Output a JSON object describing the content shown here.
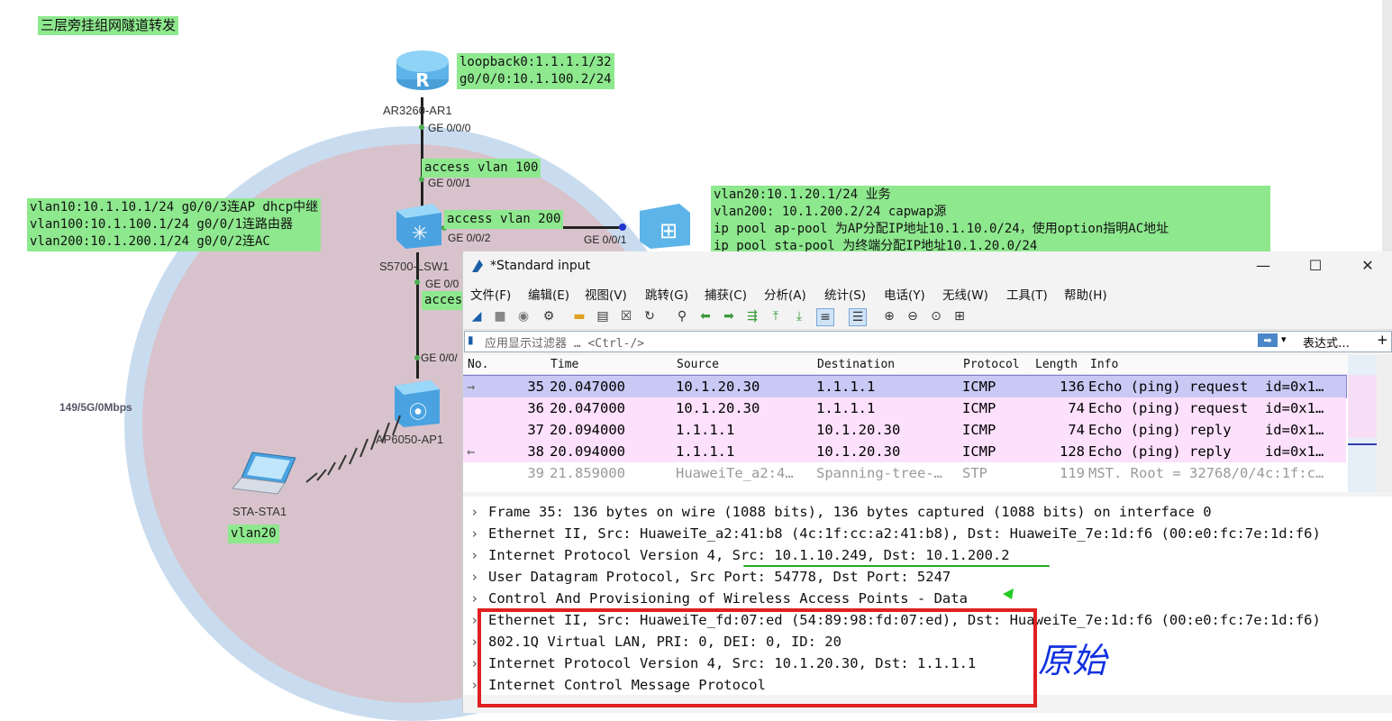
{
  "diagram": {
    "title": "三层旁挂组网隧道转发",
    "ar_info": [
      "loopback0:1.1.1.1/32",
      "g0/0/0:10.1.100.2/24"
    ],
    "ar_name": "AR3260-AR1",
    "ar_port": "GE 0/0/0",
    "access_vlan_100": "access vlan 100",
    "lsw_port_up": "GE 0/0/1",
    "access_vlan_200": "access vlan 200",
    "lsw_port_right": "GE 0/0/2",
    "ac_port": "GE 0/0/1",
    "lsw_info": [
      "vlan10:10.1.10.1/24 g0/0/3连AP dhcp中继",
      "vlan100:10.1.100.1/24 g0/0/1连路由器",
      "vlan200:10.1.200.1/24 g0/0/2连AC"
    ],
    "lsw_name": "S5700-LSW1",
    "lsw_port_down": "GE 0/0",
    "access_partial": "acces",
    "ap_port": "GE 0/0/",
    "ap_name": "AP6050-AP1",
    "wlan_rate": "149/5G/0Mbps",
    "sta_name": "STA-STA1",
    "sta_vlan": "vlan20",
    "ac_info": [
      "vlan20:10.1.20.1/24 业务",
      "vlan200: 10.1.200.2/24 capwap源",
      "ip pool ap-pool 为AP分配IP地址10.1.10.0/24，使用option指明AC地址",
      "ip pool sta-pool 为终端分配IP地址10.1.20.0/24"
    ]
  },
  "wireshark": {
    "title": "*Standard input",
    "menu": [
      "文件(F)",
      "编辑(E)",
      "视图(V)",
      "跳转(G)",
      "捕获(C)",
      "分析(A)",
      "统计(S)",
      "电话(Y)",
      "无线(W)",
      "工具(T)",
      "帮助(H)"
    ],
    "filter_placeholder": "应用显示过滤器 … <Ctrl-/>",
    "expression_label": "表达式…",
    "columns": [
      "No.",
      "Time",
      "Source",
      "Destination",
      "Protocol",
      "Length",
      "Info"
    ],
    "packets": [
      {
        "no": "35",
        "time": "20.047000",
        "src": "10.1.20.30",
        "dst": "1.1.1.1",
        "proto": "ICMP",
        "len": "136",
        "info": "Echo (ping) request  id=0x1…"
      },
      {
        "no": "36",
        "time": "20.047000",
        "src": "10.1.20.30",
        "dst": "1.1.1.1",
        "proto": "ICMP",
        "len": "74",
        "info": "Echo (ping) request  id=0x1…"
      },
      {
        "no": "37",
        "time": "20.094000",
        "src": "1.1.1.1",
        "dst": "10.1.20.30",
        "proto": "ICMP",
        "len": "74",
        "info": "Echo (ping) reply    id=0x1…"
      },
      {
        "no": "38",
        "time": "20.094000",
        "src": "1.1.1.1",
        "dst": "10.1.20.30",
        "proto": "ICMP",
        "len": "128",
        "info": "Echo (ping) reply    id=0x1…"
      },
      {
        "no": "39",
        "time": "21.859000",
        "src": "HuaweiTe_a2:4…",
        "dst": "Spanning-tree-…",
        "proto": "STP",
        "len": "119",
        "info": "MST. Root = 32768/0/4c:1f:c…"
      }
    ],
    "details": [
      "Frame 35: 136 bytes on wire (1088 bits), 136 bytes captured (1088 bits) on interface 0",
      "Ethernet II, Src: HuaweiTe_a2:41:b8 (4c:1f:cc:a2:41:b8), Dst: HuaweiTe_7e:1d:f6 (00:e0:fc:7e:1d:f6)",
      "Internet Protocol Version 4, Src: 10.1.10.249, Dst: 10.1.200.2",
      "User Datagram Protocol, Src Port: 54778, Dst Port: 5247",
      "Control And Provisioning of Wireless Access Points - Data",
      "Ethernet II, Src: HuaweiTe_fd:07:ed (54:89:98:fd:07:ed), Dst: HuaweiTe_7e:1d:f6 (00:e0:fc:7e:1d:f6)",
      "802.1Q Virtual LAN, PRI: 0, DEI: 0, ID: 20",
      "Internet Protocol Version 4, Src: 10.1.20.30, Dst: 1.1.1.1",
      "Internet Control Message Protocol"
    ],
    "annotation": "原始"
  }
}
